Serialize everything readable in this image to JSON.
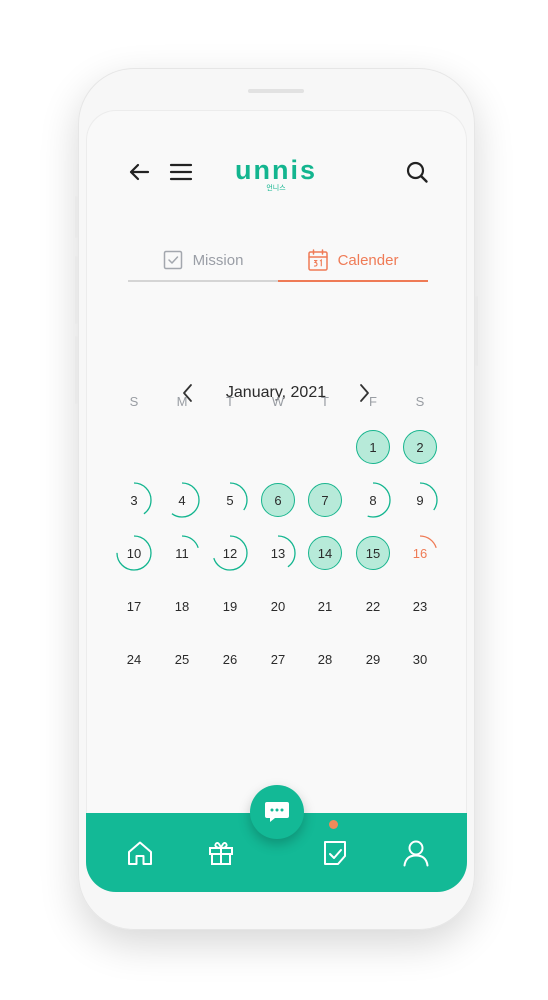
{
  "app": {
    "logo": "unnis",
    "logo_sub": "언니스"
  },
  "icons": {
    "back": "arrow-left-icon",
    "menu": "hamburger-menu-icon",
    "search": "search-icon",
    "mission": "checkbox-icon",
    "calendar": "calendar-icon",
    "chat": "chat-bubble-icon",
    "home": "home-icon",
    "gift": "gift-icon",
    "check": "check-note-icon",
    "profile": "user-icon"
  },
  "tabs": [
    {
      "label": "Mission",
      "active": false
    },
    {
      "label": "Calender",
      "active": true
    }
  ],
  "calendar": {
    "month_label": "January, 2021",
    "weekdays": [
      "S",
      "M",
      "T",
      "W",
      "T",
      "F",
      "S"
    ],
    "days": [
      {
        "day": "1",
        "status": "done"
      },
      {
        "day": "2",
        "status": "done"
      },
      {
        "day": "3",
        "status": "partial",
        "progress": 0.4
      },
      {
        "day": "4",
        "status": "partial",
        "progress": 0.6
      },
      {
        "day": "5",
        "status": "partial",
        "progress": 0.35
      },
      {
        "day": "6",
        "status": "done"
      },
      {
        "day": "7",
        "status": "done"
      },
      {
        "day": "8",
        "status": "partial",
        "progress": 0.55
      },
      {
        "day": "9",
        "status": "partial",
        "progress": 0.35
      },
      {
        "day": "10",
        "status": "partial",
        "progress": 0.75
      },
      {
        "day": "11",
        "status": "partial",
        "progress": 0.2
      },
      {
        "day": "12",
        "status": "partial",
        "progress": 0.7
      },
      {
        "day": "13",
        "status": "partial",
        "progress": 0.4
      },
      {
        "day": "14",
        "status": "done"
      },
      {
        "day": "15",
        "status": "done"
      },
      {
        "day": "16",
        "status": "today",
        "progress": 0.2
      },
      {
        "day": "17",
        "status": "none"
      },
      {
        "day": "18",
        "status": "none"
      },
      {
        "day": "19",
        "status": "none"
      },
      {
        "day": "20",
        "status": "none"
      },
      {
        "day": "21",
        "status": "none"
      },
      {
        "day": "22",
        "status": "none"
      },
      {
        "day": "23",
        "status": "none"
      },
      {
        "day": "24",
        "status": "none"
      },
      {
        "day": "25",
        "status": "none"
      },
      {
        "day": "26",
        "status": "none"
      },
      {
        "day": "27",
        "status": "none"
      },
      {
        "day": "28",
        "status": "none"
      },
      {
        "day": "29",
        "status": "none"
      },
      {
        "day": "30",
        "status": "none"
      }
    ]
  },
  "colors": {
    "brand": "#13b58f",
    "accent": "#ef7b56",
    "done_fill": "#b7ead9",
    "nav_bg": "#13b996"
  }
}
